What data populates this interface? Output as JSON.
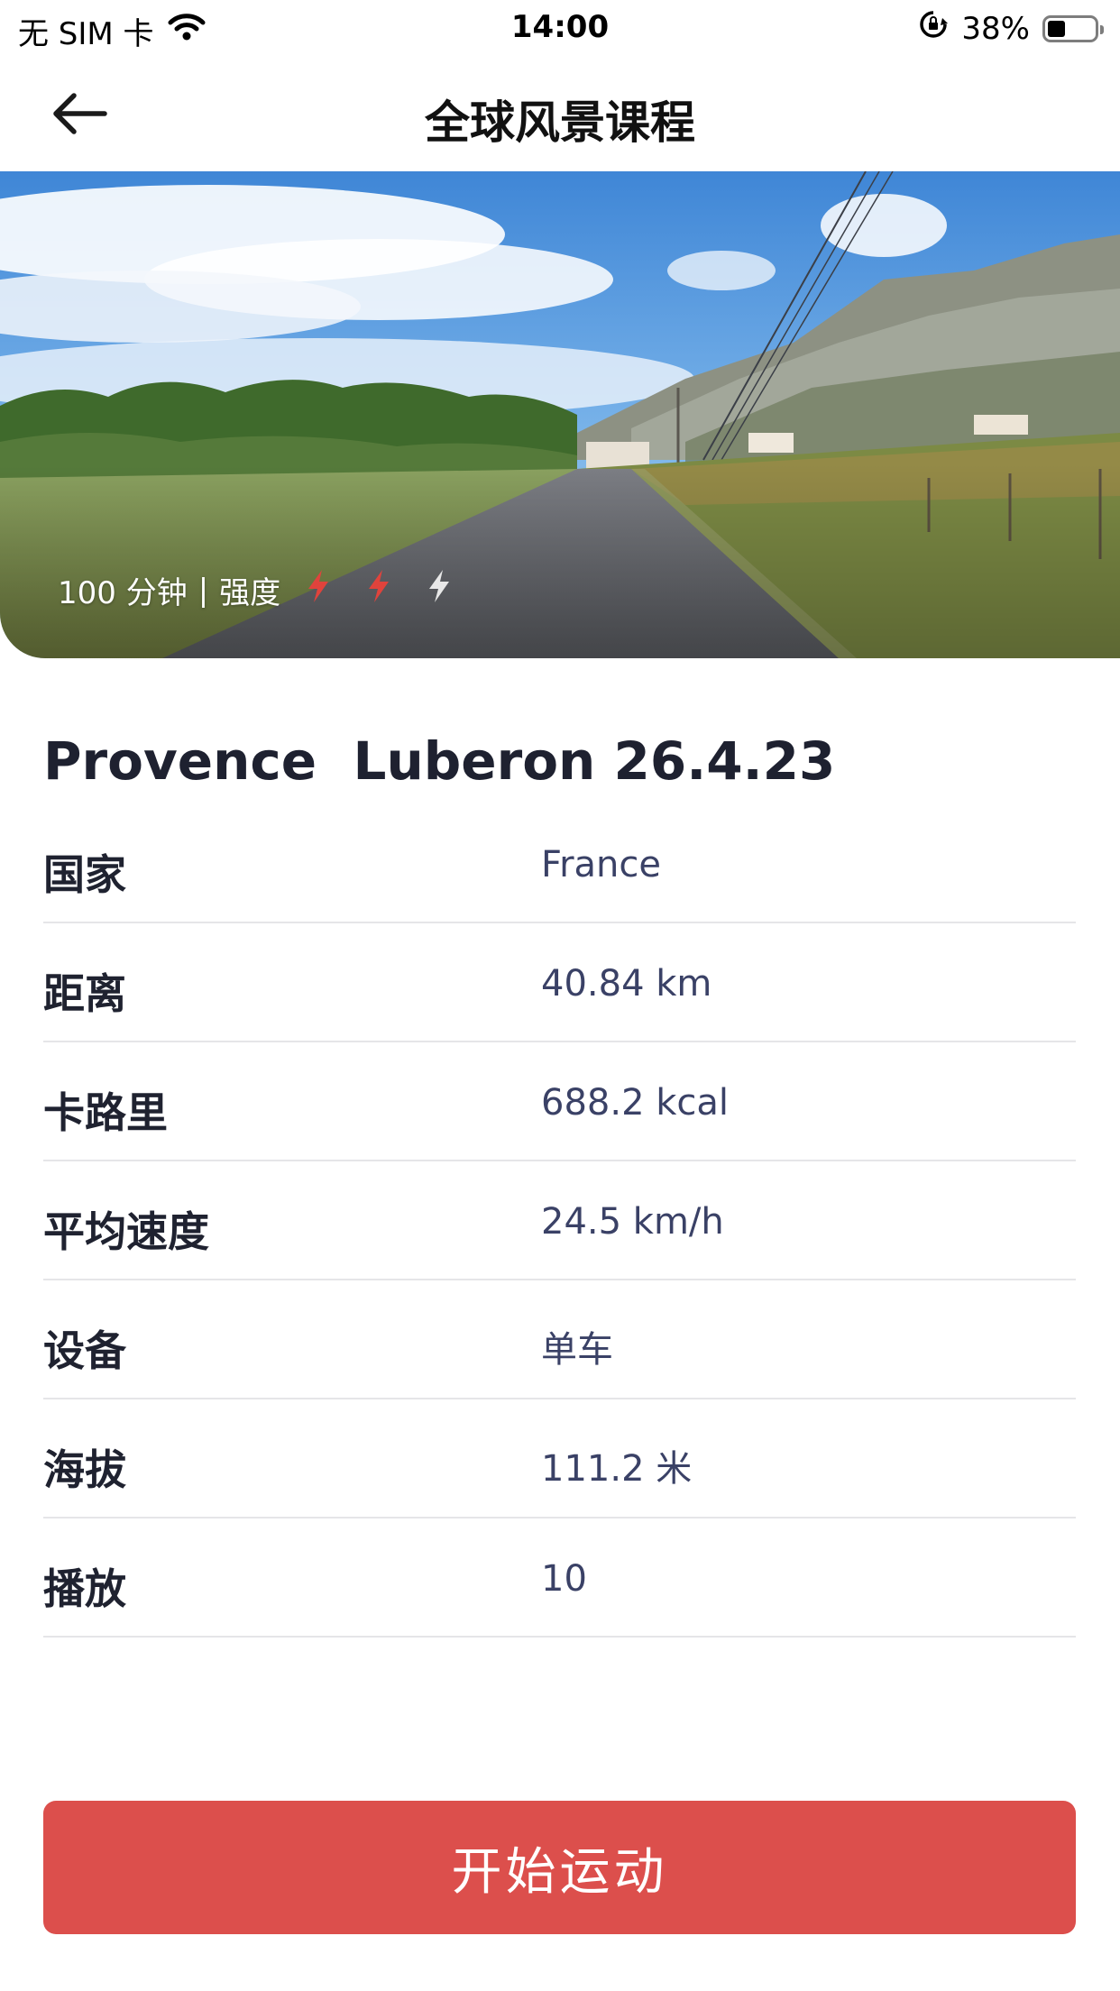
{
  "status_bar": {
    "carrier": "无 SIM 卡",
    "time": "14:00",
    "battery_text": "38%",
    "battery_level": 0.38
  },
  "nav": {
    "title": "全球风景课程",
    "back_icon": "arrow-left-icon"
  },
  "hero": {
    "duration": "100 分钟",
    "separator": "|",
    "intensity_label": "强度",
    "intensity_level": 2,
    "intensity_max": 3,
    "bolt_active_color": "#e0433c",
    "bolt_inactive_color": "#e8e8e8"
  },
  "course": {
    "title": "Provence  Luberon 26.4.23",
    "details": [
      {
        "label": "国家",
        "value": "France"
      },
      {
        "label": "距离",
        "value": "40.84 km"
      },
      {
        "label": "卡路里",
        "value": "688.2 kcal"
      },
      {
        "label": "平均速度",
        "value": "24.5 km/h"
      },
      {
        "label": "设备",
        "value": "单车"
      },
      {
        "label": "海拔",
        "value": "111.2 米"
      },
      {
        "label": "播放",
        "value": "10"
      }
    ]
  },
  "actions": {
    "start_label": "开始运动",
    "accent_color": "#dc4f4c"
  }
}
